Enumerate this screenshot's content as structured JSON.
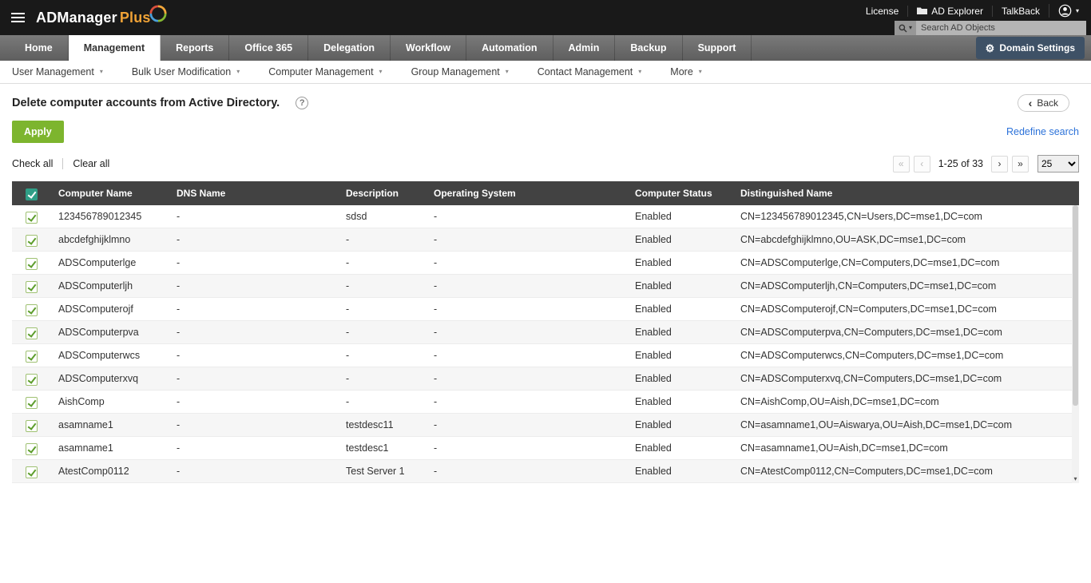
{
  "topbar": {
    "brand": {
      "name": "ADManager",
      "plus": "Plus"
    },
    "links": {
      "license": "License",
      "ad_explorer": "AD Explorer",
      "talkback": "TalkBack"
    },
    "search": {
      "placeholder": "Search AD Objects"
    }
  },
  "nav": {
    "tabs": [
      {
        "label": "Home"
      },
      {
        "label": "Management",
        "active": true
      },
      {
        "label": "Reports"
      },
      {
        "label": "Office 365"
      },
      {
        "label": "Delegation"
      },
      {
        "label": "Workflow"
      },
      {
        "label": "Automation"
      },
      {
        "label": "Admin"
      },
      {
        "label": "Backup"
      },
      {
        "label": "Support"
      }
    ],
    "domain_settings": "Domain Settings"
  },
  "subnav": {
    "items": [
      {
        "label": "User Management"
      },
      {
        "label": "Bulk User Modification"
      },
      {
        "label": "Computer Management"
      },
      {
        "label": "Group Management"
      },
      {
        "label": "Contact Management"
      },
      {
        "label": "More"
      }
    ]
  },
  "page": {
    "title": "Delete computer accounts from Active Directory.",
    "back_label": "Back",
    "apply_label": "Apply",
    "redefine_search": "Redefine search",
    "check_all": "Check all",
    "clear_all": "Clear all"
  },
  "pagination": {
    "range": "1-25 of 33",
    "page_size": "25",
    "icons": {
      "first": "«",
      "prev": "‹",
      "next": "›",
      "last": "»"
    }
  },
  "table": {
    "columns": [
      "Computer Name",
      "DNS Name",
      "Description",
      "Operating System",
      "Computer Status",
      "Distinguished Name"
    ],
    "rows": [
      {
        "name": "123456789012345",
        "dns": "-",
        "desc": "sdsd",
        "os": "-",
        "status": "Enabled",
        "dn": "CN=123456789012345,CN=Users,DC=mse1,DC=com"
      },
      {
        "name": "abcdefghijklmno",
        "dns": "-",
        "desc": "-",
        "os": "-",
        "status": "Enabled",
        "dn": "CN=abcdefghijklmno,OU=ASK,DC=mse1,DC=com"
      },
      {
        "name": "ADSComputerlge",
        "dns": "-",
        "desc": "-",
        "os": "-",
        "status": "Enabled",
        "dn": "CN=ADSComputerlge,CN=Computers,DC=mse1,DC=com"
      },
      {
        "name": "ADSComputerljh",
        "dns": "-",
        "desc": "-",
        "os": "-",
        "status": "Enabled",
        "dn": "CN=ADSComputerljh,CN=Computers,DC=mse1,DC=com"
      },
      {
        "name": "ADSComputerojf",
        "dns": "-",
        "desc": "-",
        "os": "-",
        "status": "Enabled",
        "dn": "CN=ADSComputerojf,CN=Computers,DC=mse1,DC=com"
      },
      {
        "name": "ADSComputerpva",
        "dns": "-",
        "desc": "-",
        "os": "-",
        "status": "Enabled",
        "dn": "CN=ADSComputerpva,CN=Computers,DC=mse1,DC=com"
      },
      {
        "name": "ADSComputerwcs",
        "dns": "-",
        "desc": "-",
        "os": "-",
        "status": "Enabled",
        "dn": "CN=ADSComputerwcs,CN=Computers,DC=mse1,DC=com"
      },
      {
        "name": "ADSComputerxvq",
        "dns": "-",
        "desc": "-",
        "os": "-",
        "status": "Enabled",
        "dn": "CN=ADSComputerxvq,CN=Computers,DC=mse1,DC=com"
      },
      {
        "name": "AishComp",
        "dns": "-",
        "desc": "-",
        "os": "-",
        "status": "Enabled",
        "dn": "CN=AishComp,OU=Aish,DC=mse1,DC=com"
      },
      {
        "name": "asamname1",
        "dns": "-",
        "desc": "testdesc11",
        "os": "-",
        "status": "Enabled",
        "dn": "CN=asamname1,OU=Aiswarya,OU=Aish,DC=mse1,DC=com"
      },
      {
        "name": "asamname1",
        "dns": "-",
        "desc": "testdesc1",
        "os": "-",
        "status": "Enabled",
        "dn": "CN=asamname1,OU=Aish,DC=mse1,DC=com"
      },
      {
        "name": "AtestComp0112",
        "dns": "-",
        "desc": "Test Server 1",
        "os": "-",
        "status": "Enabled",
        "dn": "CN=AtestComp0112,CN=Computers,DC=mse1,DC=com"
      }
    ]
  },
  "colors": {
    "apply_green": "#7db52e",
    "link_blue": "#2c72d9",
    "brand_orange": "#f0a236",
    "table_header_dark": "#424242",
    "domain_settings_navy": "#3e5166",
    "row_checkbox_green": "#5e9e2d",
    "select_all_teal": "#2f9e86",
    "topbar_black": "#191919"
  }
}
